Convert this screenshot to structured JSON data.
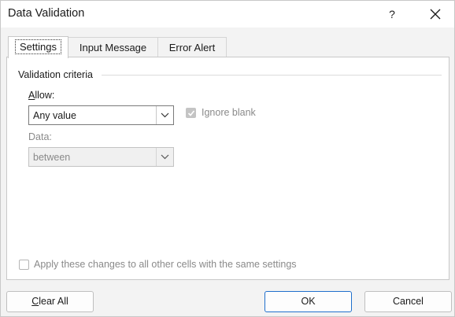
{
  "window": {
    "title": "Data Validation",
    "help_glyph": "?"
  },
  "tabs": [
    {
      "label": "Settings",
      "active": true
    },
    {
      "label": "Input Message",
      "active": false
    },
    {
      "label": "Error Alert",
      "active": false
    }
  ],
  "settings": {
    "group_label": "Validation criteria",
    "allow_label": "Allow:",
    "allow_value": "Any value",
    "ignore_blank_label": "Ignore blank",
    "ignore_blank_checked": true,
    "data_label": "Data:",
    "data_value": "between",
    "apply_all_label": "Apply these changes to all other cells with the same settings",
    "apply_all_checked": false
  },
  "buttons": {
    "clear_all": "Clear All",
    "ok": "OK",
    "cancel": "Cancel"
  },
  "colors": {
    "default_button_border": "#1f6fcc",
    "disabled_text": "#8a8a8a"
  }
}
